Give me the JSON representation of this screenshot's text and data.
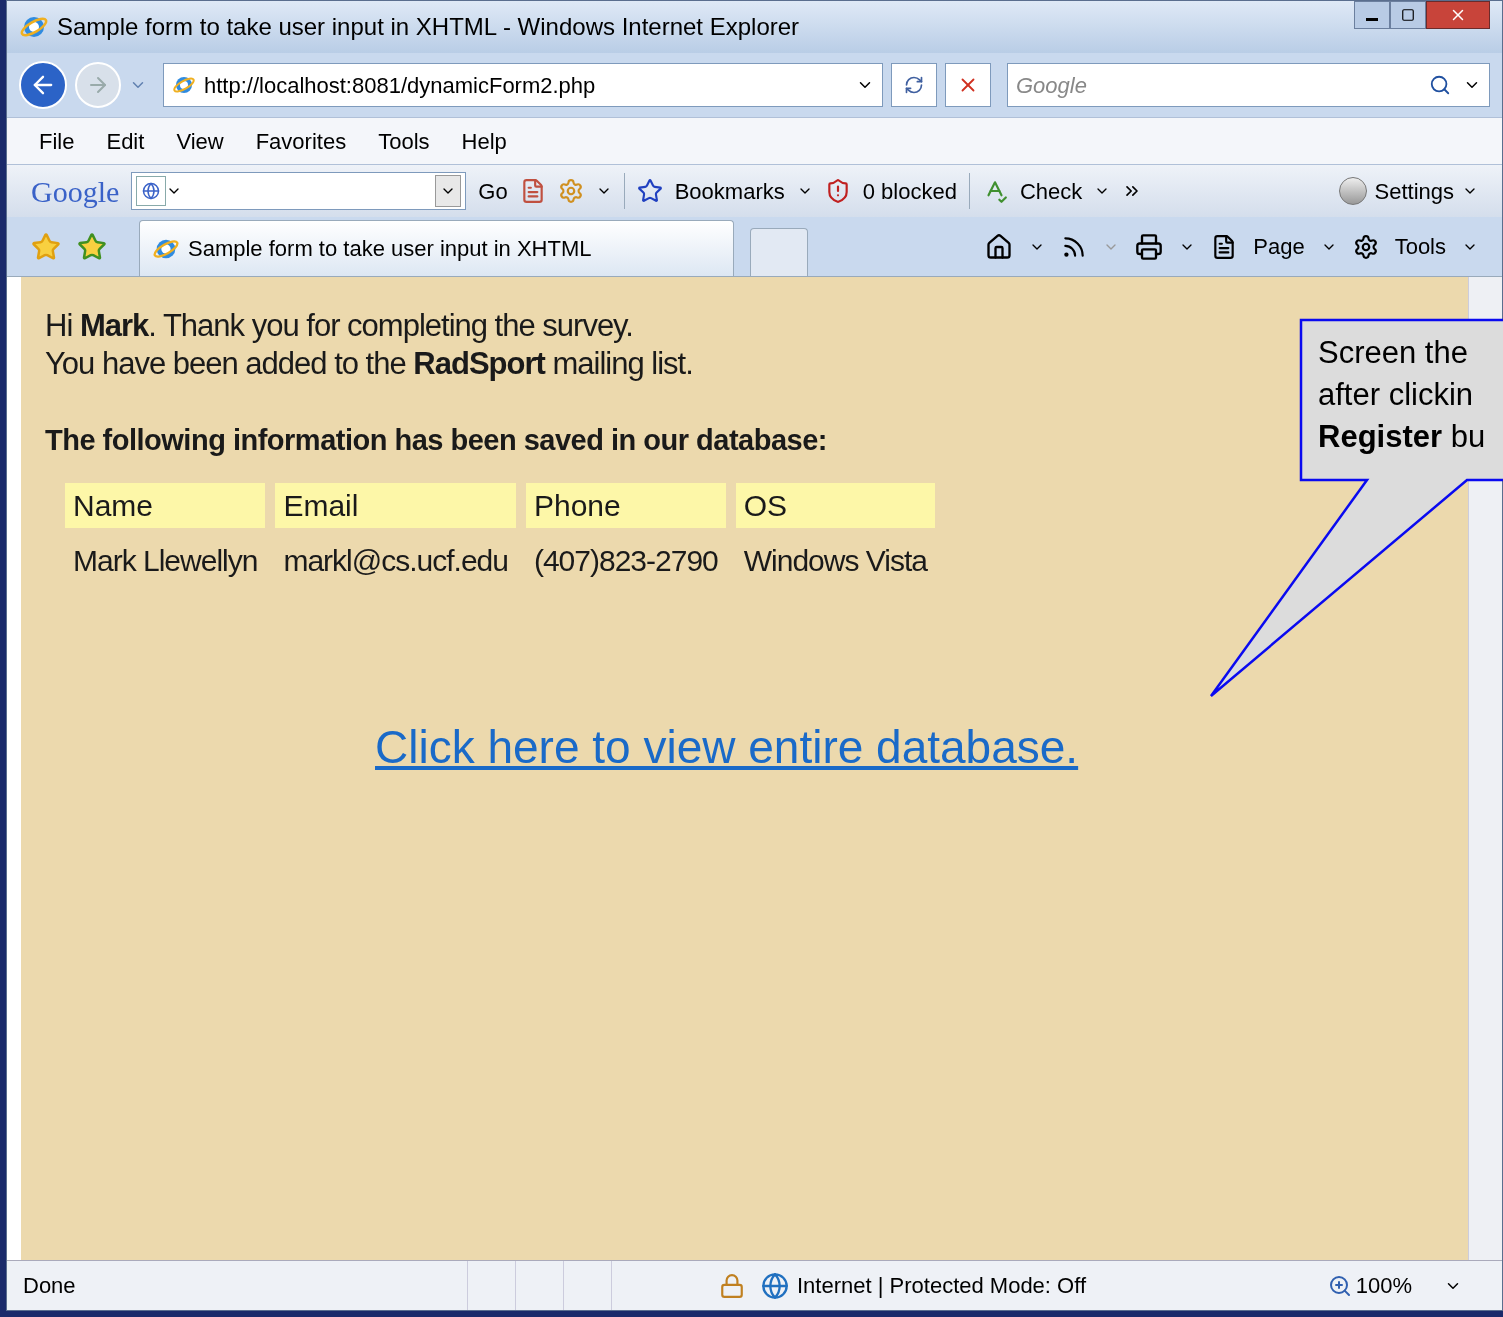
{
  "window": {
    "title": "Sample form to take user input in XHTML - Windows Internet Explorer"
  },
  "address_bar": {
    "url": "http://localhost:8081/dynamicForm2.php"
  },
  "search": {
    "placeholder": "Google"
  },
  "menu": [
    "File",
    "Edit",
    "View",
    "Favorites",
    "Tools",
    "Help"
  ],
  "google_toolbar": {
    "logo": "Google",
    "go": "Go",
    "bookmarks": "Bookmarks",
    "blocked": "0 blocked",
    "check": "Check",
    "settings": "Settings"
  },
  "tab": {
    "title": "Sample form to take user input in XHTML"
  },
  "command_bar": [
    "Page",
    "Tools"
  ],
  "page": {
    "lines": [
      "Hi **Mark**. Thank you for completing the survey.",
      "You have been added to the **RadSport** mailing list."
    ],
    "heading": "The following information has been saved in our database:",
    "table": {
      "columns": [
        "Name",
        "Email",
        "Phone",
        "OS"
      ],
      "rows": [
        [
          "Mark Llewellyn",
          "markl@cs.ucf.edu",
          "(407)823-2790",
          "Windows Vista"
        ]
      ]
    },
    "link": "Click here to view entire database."
  },
  "callout": {
    "lines": [
      "Screen the",
      "after clickin",
      "**Register** bu"
    ]
  },
  "status_bar": {
    "text": "Done",
    "zone": "Internet | Protected Mode: Off",
    "zoom": "100%"
  }
}
